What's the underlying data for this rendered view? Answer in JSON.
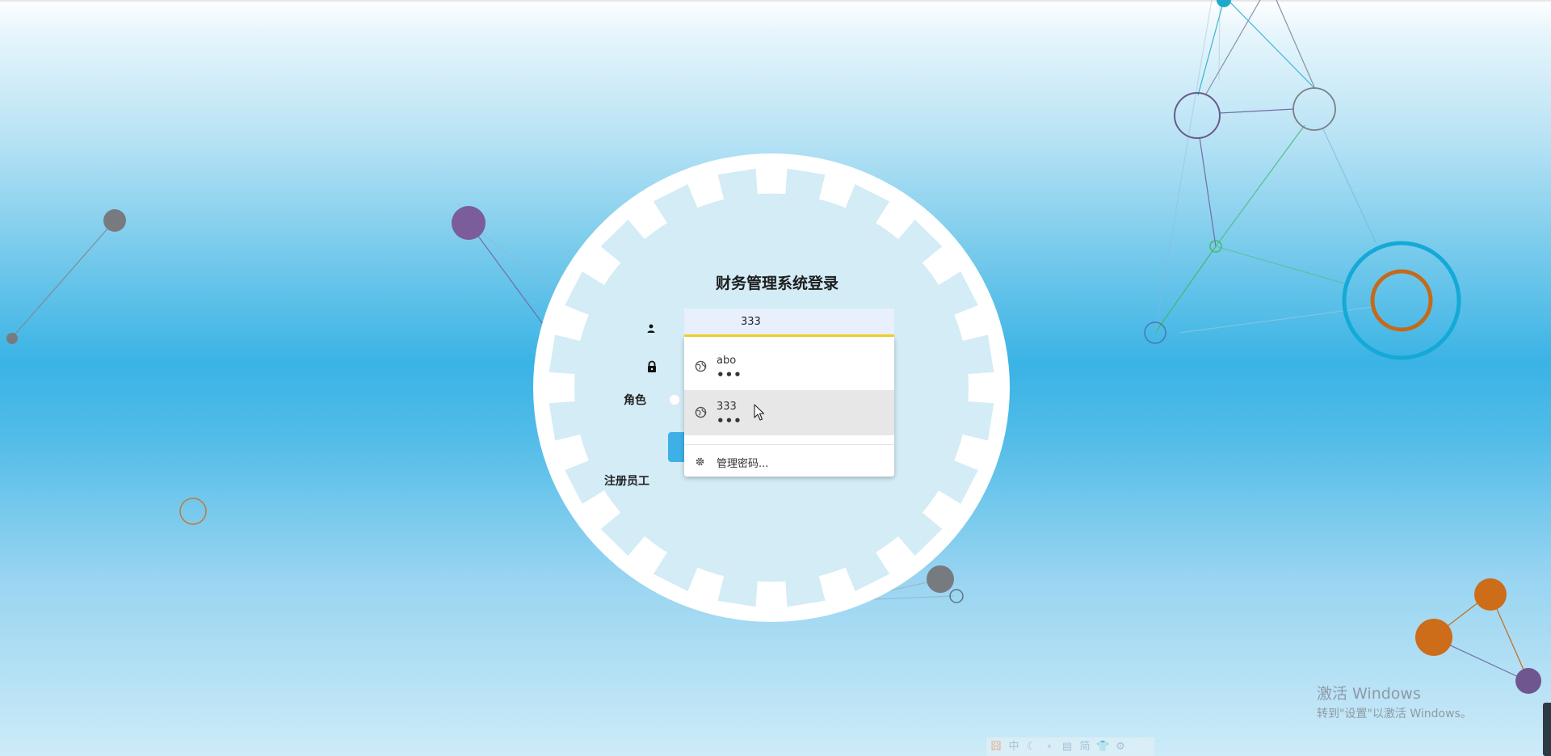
{
  "login": {
    "title": "财务管理系统登录",
    "username_value": "333",
    "role_label": "角色",
    "register_label": "注册员工"
  },
  "autofill": {
    "items": [
      {
        "username": "abo",
        "password_mask": "•••"
      },
      {
        "username": "333",
        "password_mask": "•••"
      }
    ],
    "manage_label": "管理密码..."
  },
  "watermark": {
    "title": "激活 Windows",
    "subtitle": "转到\"设置\"以激活 Windows。"
  },
  "ime_toolbar": {
    "items": [
      "囧",
      "中",
      "☾",
      "∘",
      "▤",
      "简",
      "👕",
      "⚙"
    ]
  },
  "colors": {
    "accent": "#3fb0e7",
    "autofill_bg": "#e8f0fe",
    "autofill_underline": "#f3d42c",
    "panel": "#d3ecf6"
  },
  "icons": {
    "username": "user-icon",
    "password": "lock-icon",
    "saved_password": "globe-icon",
    "manage": "gear-icon",
    "pointer": "mouse-cursor-icon"
  }
}
